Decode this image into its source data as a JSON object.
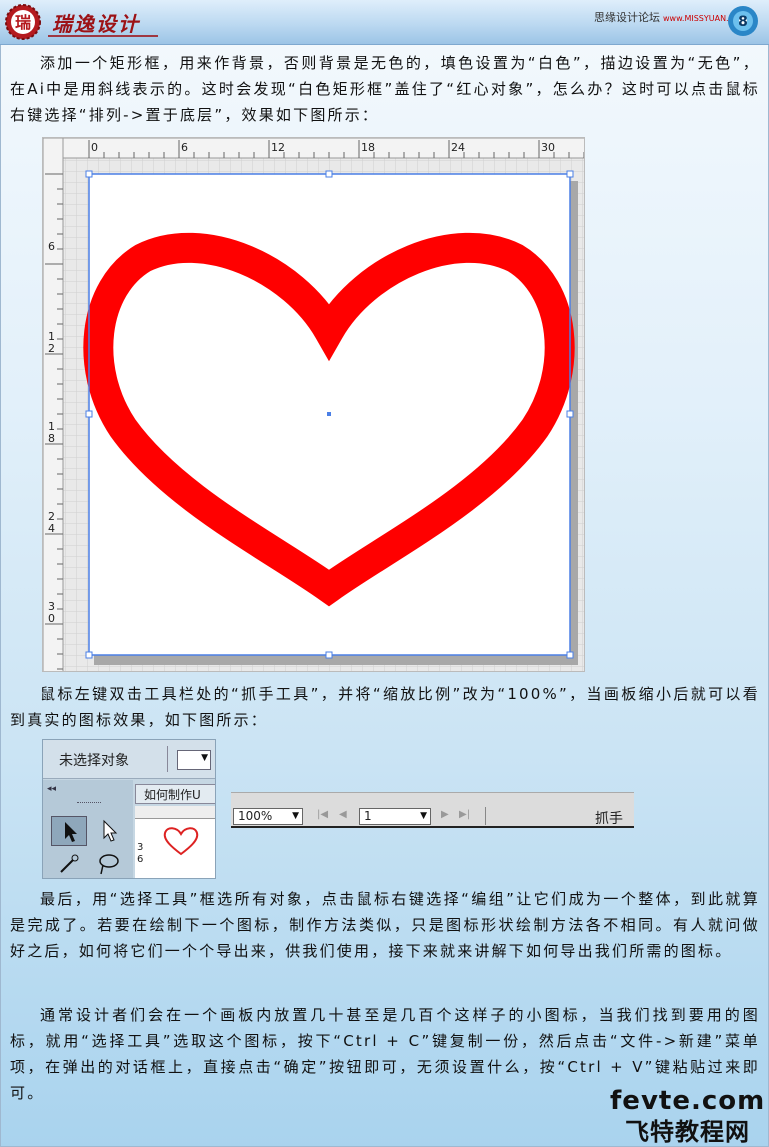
{
  "header": {
    "brand": "瑞逸设计",
    "site_name": "思缘设计论坛",
    "site_domain": "www.MISSYUAN.COM"
  },
  "paragraphs": [
    "添加一个矩形框，用来作背景，否则背景是无色的，填色设置为“白色”，描边设置为“无色”，在Ai中是用斜线表示的。这时会发现“白色矩形框”盖住了“红心对象”，怎么办？这时可以点击鼠标右键选择“排列->置于底层”，效果如下图所示：",
    "鼠标左键双击工具栏处的“抓手工具”，并将“缩放比例”改为“100%”，当画板缩小后就可以看到真实的图标效果，如下图所示：",
    "最后，用“选择工具”框选所有对象，点击鼠标右键选择“编组”让它们成为一个整体，到此就算是完成了。若要在绘制下一个图标，制作方法类似，只是图标形状绘制方法各不相同。有人就问做好之后，如何将它们一个个导出来，供我们使用，接下来就来讲解下如何导出我们所需的图标。",
    "通常设计者们会在一个画板内放置几十甚至是几百个这样子的小图标，当我们找到要用的图标，就用“选择工具”选取这个图标，按下“Ctrl + C”键复制一份，然后点击“文件->新建”菜单项，在弹出的对话框上，直接点击“确定”按钮即可，无须设置什么，按“Ctrl + V”键粘贴过来即可。"
  ],
  "canvas": {
    "ruler_h": [
      "0",
      "6",
      "12",
      "18",
      "24",
      "30"
    ],
    "ruler_v": [
      "6",
      "12",
      "18",
      "24",
      "30"
    ],
    "heart_color": "#ff0000",
    "selection_color": "#4a7fe6"
  },
  "toolbar_panel": {
    "no_selection": "未选择对象",
    "doc_tab": "如何制作U",
    "ruler_nums": [
      "3",
      "6"
    ]
  },
  "status_bar": {
    "zoom": "100%",
    "page": "1",
    "tool": "抓手"
  },
  "watermark": {
    "line1": "fevte.com",
    "line2": "飞特教程网"
  }
}
